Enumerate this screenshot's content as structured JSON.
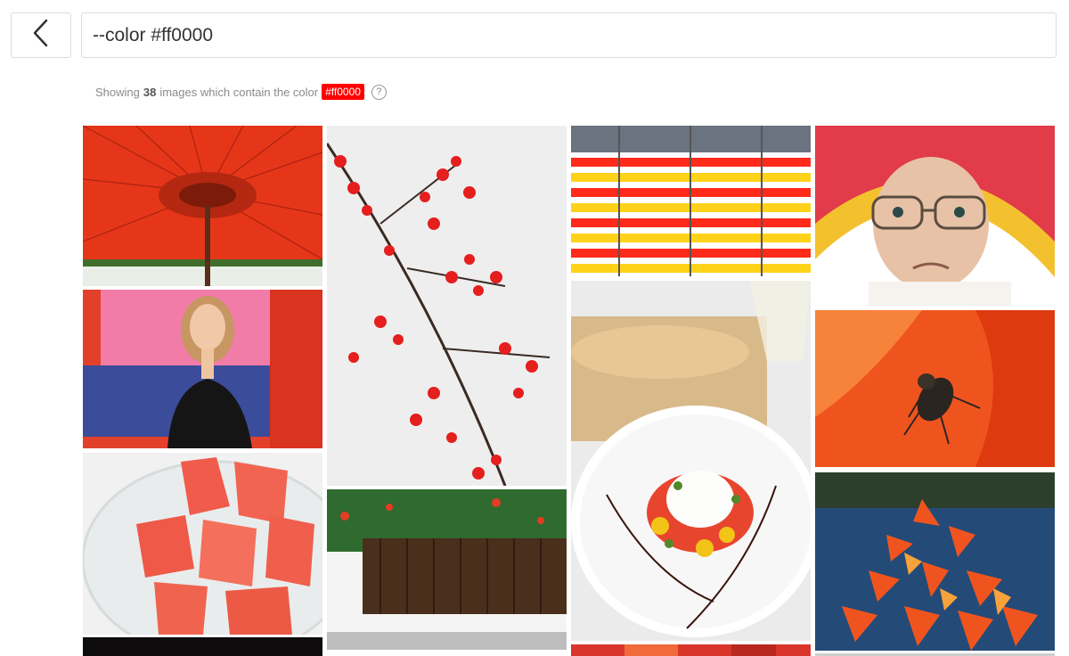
{
  "search": {
    "query": "--color #ff0000"
  },
  "summary": {
    "prefix": "Showing",
    "count": "38",
    "middle": "images which contain the color",
    "color_chip": "#ff0000",
    "help_symbol": "?"
  },
  "colors": {
    "accent": "#ff0000",
    "border": "#dcdcdc"
  },
  "grid": {
    "columns": 4,
    "images": [
      {
        "subject": "red umbrella"
      },
      {
        "subject": "woman by pink red blue wall"
      },
      {
        "subject": "watermelon pieces"
      },
      {
        "subject": "red berry branch"
      },
      {
        "subject": "ivy over wooden fence"
      },
      {
        "subject": "red and yellow striped wall"
      },
      {
        "subject": "salad plate with bread and wine"
      },
      {
        "subject": "elderly woman with red hat"
      },
      {
        "subject": "fly on red petal"
      },
      {
        "subject": "orange autumn leaves"
      }
    ]
  }
}
